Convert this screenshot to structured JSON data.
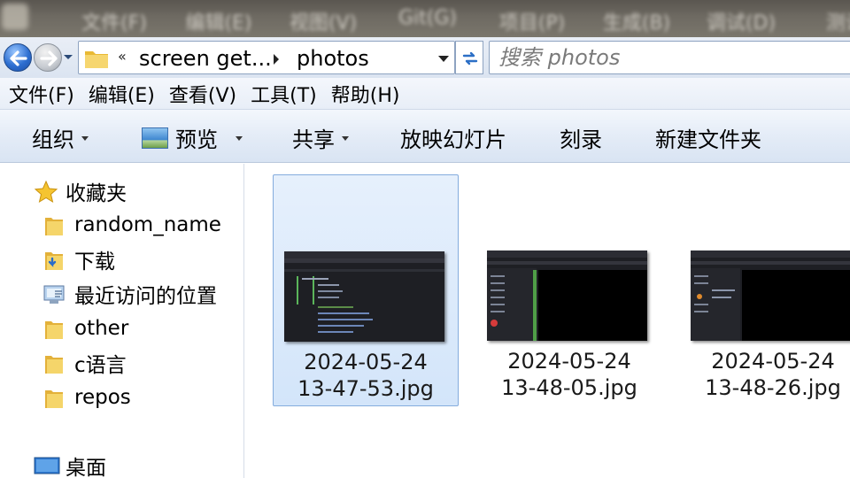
{
  "title_bar": {
    "blurred_menu": [
      "文件(F)",
      "编辑(E)",
      "视图(V)",
      "Git(G)",
      "项目(P)",
      "生成(B)",
      "调试(D)",
      "测试"
    ]
  },
  "address_bar": {
    "crumb_chevron": "«",
    "crumbs": [
      "screen get...",
      "photos"
    ]
  },
  "search": {
    "placeholder": "搜索 photos"
  },
  "menu": [
    "文件(F)",
    "编辑(E)",
    "查看(V)",
    "工具(T)",
    "帮助(H)"
  ],
  "toolbar": {
    "organize": "组织",
    "preview": "预览",
    "share": "共享",
    "slideshow": "放映幻灯片",
    "burn": "刻录",
    "new_folder": "新建文件夹"
  },
  "nav": {
    "favorites": "收藏夹",
    "items": [
      "random_name",
      "下载",
      "最近访问的位置",
      "other",
      "c语言",
      "repos"
    ],
    "desktop": "桌面"
  },
  "files": [
    {
      "date": "2024-05-24",
      "time": "13-47-53.jpg",
      "selected": true
    },
    {
      "date": "2024-05-24",
      "time": "13-48-05.jpg",
      "selected": false
    },
    {
      "date": "2024-05-24",
      "time": "13-48-26.jpg",
      "selected": false
    }
  ],
  "colors": {
    "selection": "#cfe3fa",
    "toolbar_bg": "#e4ecf7",
    "folder": "#f0c84e"
  }
}
